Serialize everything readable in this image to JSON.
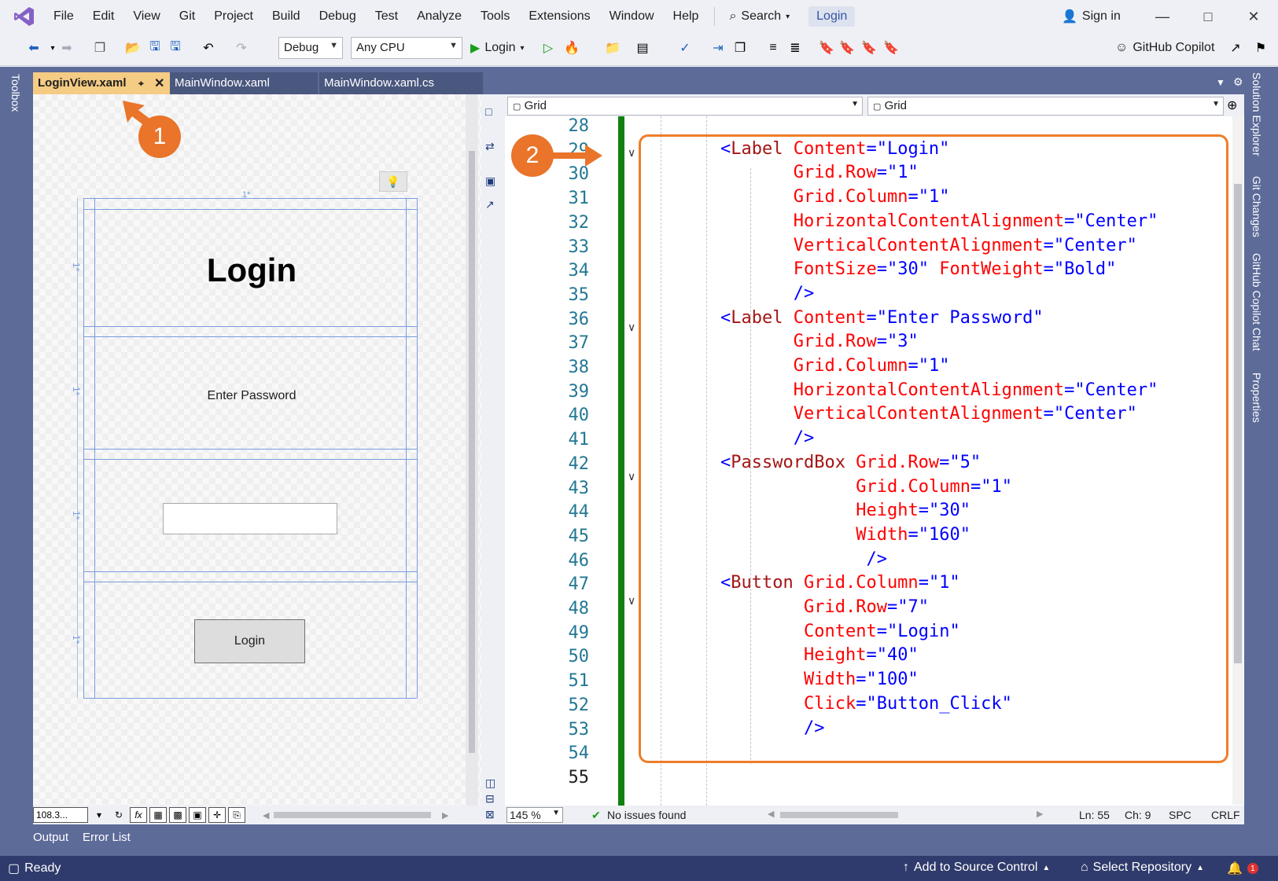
{
  "menubar": {
    "items": [
      "File",
      "Edit",
      "View",
      "Git",
      "Project",
      "Build",
      "Debug",
      "Test",
      "Analyze",
      "Tools",
      "Extensions",
      "Window",
      "Help"
    ],
    "search_label": "Search",
    "solution_name": "Login",
    "sign_in": "Sign in"
  },
  "toolbar": {
    "config": "Debug",
    "platform": "Any CPU",
    "run_target": "Login",
    "copilot": "GitHub Copilot"
  },
  "tabs": [
    {
      "label": "LoginView.xaml",
      "active": true
    },
    {
      "label": "MainWindow.xaml",
      "active": false
    },
    {
      "label": "MainWindow.xaml.cs",
      "active": false
    }
  ],
  "left_sidebar": {
    "toolbox": "Toolbox"
  },
  "right_sidebar": [
    "Solution Explorer",
    "Git Changes",
    "GitHub Copilot Chat",
    "Properties"
  ],
  "designer": {
    "title_label": "Login",
    "password_label": "Enter Password",
    "button_label": "Login",
    "row_marker": "1*",
    "zoom": "108.3...",
    "fx": "fx"
  },
  "editor": {
    "nav_left": "Grid",
    "nav_right": "Grid",
    "zoom": "145 %",
    "issues": "No issues found",
    "line": "Ln: 55",
    "col": "Ch: 9",
    "spc": "SPC",
    "eol": "CRLF",
    "line_numbers": [
      "28",
      "29",
      "30",
      "31",
      "32",
      "33",
      "34",
      "35",
      "36",
      "37",
      "38",
      "39",
      "40",
      "41",
      "42",
      "43",
      "44",
      "45",
      "46",
      "47",
      "48",
      "49",
      "50",
      "51",
      "52",
      "53",
      "54",
      "55"
    ],
    "lines": [
      [],
      [
        [
          "b",
          "<"
        ],
        [
          "t",
          "Label"
        ],
        [
          "a",
          " Content"
        ],
        [
          "b",
          "="
        ],
        [
          "v",
          "\"Login\""
        ]
      ],
      [
        [
          "a",
          "Grid.Row"
        ],
        [
          "b",
          "="
        ],
        [
          "v",
          "\"1\""
        ]
      ],
      [
        [
          "a",
          "Grid.Column"
        ],
        [
          "b",
          "="
        ],
        [
          "v",
          "\"1\""
        ]
      ],
      [
        [
          "a",
          "HorizontalContentAlignment"
        ],
        [
          "b",
          "="
        ],
        [
          "v",
          "\"Center\""
        ]
      ],
      [
        [
          "a",
          "VerticalContentAlignment"
        ],
        [
          "b",
          "="
        ],
        [
          "v",
          "\"Center\""
        ]
      ],
      [
        [
          "a",
          "FontSize"
        ],
        [
          "b",
          "="
        ],
        [
          "v",
          "\"30\""
        ],
        [
          "a",
          " FontWeight"
        ],
        [
          "b",
          "="
        ],
        [
          "v",
          "\"Bold\""
        ]
      ],
      [
        [
          "b",
          "/>"
        ]
      ],
      [
        [
          "b",
          "<"
        ],
        [
          "t",
          "Label"
        ],
        [
          "a",
          " Content"
        ],
        [
          "b",
          "="
        ],
        [
          "v",
          "\"Enter Password\""
        ]
      ],
      [
        [
          "a",
          "Grid.Row"
        ],
        [
          "b",
          "="
        ],
        [
          "v",
          "\"3\""
        ]
      ],
      [
        [
          "a",
          "Grid.Column"
        ],
        [
          "b",
          "="
        ],
        [
          "v",
          "\"1\""
        ]
      ],
      [
        [
          "a",
          "HorizontalContentAlignment"
        ],
        [
          "b",
          "="
        ],
        [
          "v",
          "\"Center\""
        ]
      ],
      [
        [
          "a",
          "VerticalContentAlignment"
        ],
        [
          "b",
          "="
        ],
        [
          "v",
          "\"Center\""
        ]
      ],
      [
        [
          "b",
          "/>"
        ]
      ],
      [
        [
          "b",
          "<"
        ],
        [
          "t",
          "PasswordBox"
        ],
        [
          "a",
          " Grid.Row"
        ],
        [
          "b",
          "="
        ],
        [
          "v",
          "\"5\""
        ]
      ],
      [
        [
          "a",
          "Grid.Column"
        ],
        [
          "b",
          "="
        ],
        [
          "v",
          "\"1\""
        ]
      ],
      [
        [
          "a",
          "Height"
        ],
        [
          "b",
          "="
        ],
        [
          "v",
          "\"30\""
        ]
      ],
      [
        [
          "a",
          "Width"
        ],
        [
          "b",
          "="
        ],
        [
          "v",
          "\"160\""
        ]
      ],
      [
        [
          "b",
          "/>"
        ]
      ],
      [
        [
          "b",
          "<"
        ],
        [
          "t",
          "Button"
        ],
        [
          "a",
          " Grid.Column"
        ],
        [
          "b",
          "="
        ],
        [
          "v",
          "\"1\""
        ]
      ],
      [
        [
          "a",
          "Grid.Row"
        ],
        [
          "b",
          "="
        ],
        [
          "v",
          "\"7\""
        ]
      ],
      [
        [
          "a",
          "Content"
        ],
        [
          "b",
          "="
        ],
        [
          "v",
          "\"Login\""
        ]
      ],
      [
        [
          "a",
          "Height"
        ],
        [
          "b",
          "="
        ],
        [
          "v",
          "\"40\""
        ]
      ],
      [
        [
          "a",
          "Width"
        ],
        [
          "b",
          "="
        ],
        [
          "v",
          "\"100\""
        ]
      ],
      [
        [
          "a",
          "Click"
        ],
        [
          "b",
          "="
        ],
        [
          "v",
          "\"Button_Click\""
        ]
      ],
      [
        [
          "b",
          "/>"
        ]
      ],
      [],
      []
    ]
  },
  "callouts": {
    "first": "1",
    "second": "2"
  },
  "bottom_tabs": [
    "Output",
    "Error List"
  ],
  "statusbar": {
    "ready": "Ready",
    "source_control": "Add to Source Control",
    "repository": "Select Repository",
    "notifications": "1"
  }
}
